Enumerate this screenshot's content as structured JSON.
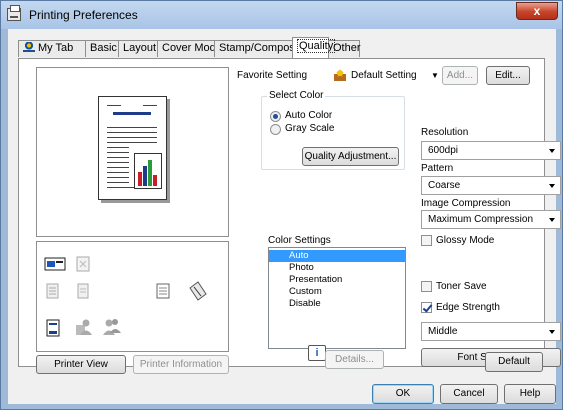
{
  "window": {
    "title": "Printing Preferences",
    "close_glyph": "x"
  },
  "tabs": [
    {
      "label": "My Tab",
      "icon": "my-tab-icon"
    },
    {
      "label": "Basic"
    },
    {
      "label": "Layout"
    },
    {
      "label": "Cover Mode"
    },
    {
      "label": "Stamp/Composition"
    },
    {
      "label": "Quality",
      "active": true
    },
    {
      "label": "Other"
    }
  ],
  "favorite": {
    "label": "Favorite Setting",
    "value": "Default Setting",
    "add_label": "Add...",
    "edit_label": "Edit..."
  },
  "select_color": {
    "label": "Select Color",
    "options": [
      "Auto Color",
      "Gray Scale"
    ],
    "selected": "Auto Color"
  },
  "quality_adjustment_label": "Quality Adjustment...",
  "color_settings": {
    "label": "Color Settings",
    "items": [
      "Auto",
      "Photo",
      "Presentation",
      "Custom",
      "Disable"
    ],
    "selected": "Auto",
    "details_label": "Details..."
  },
  "resolution": {
    "label": "Resolution",
    "value": "600dpi"
  },
  "pattern": {
    "label": "Pattern",
    "value": "Coarse"
  },
  "image_compression": {
    "label": "Image Compression",
    "value": "Maximum Compression"
  },
  "glossy_mode": {
    "label": "Glossy Mode",
    "checked": false
  },
  "toner_save": {
    "label": "Toner Save",
    "checked": false
  },
  "edge_strength": {
    "label": "Edge Strength",
    "checked": true,
    "value": "Middle"
  },
  "font_settings_label": "Font Settings...",
  "default_label": "Default",
  "printer_view_label": "Printer View",
  "printer_information_label": "Printer Information",
  "footer": {
    "ok": "OK",
    "cancel": "Cancel",
    "help": "Help"
  },
  "colors": {
    "selection": "#3399ff",
    "accent_blue": "#1d3c8a"
  }
}
